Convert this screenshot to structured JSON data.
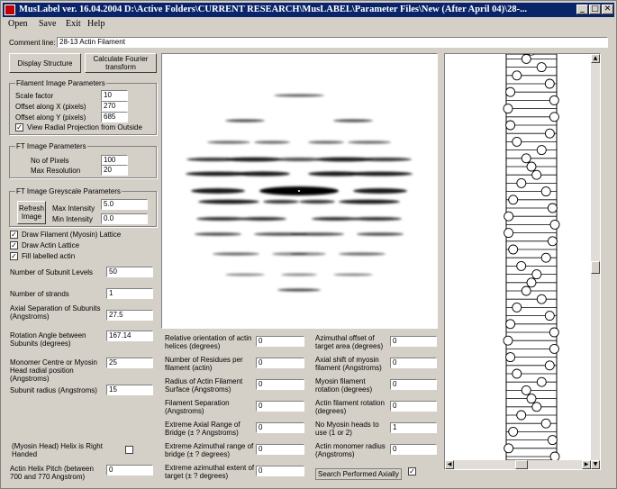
{
  "window": {
    "title": "MusLabel ver. 16.04.2004  D:\\Active Folders\\CURRENT RESEARCH\\MusLABEL\\Parameter Files\\New (After April 04)\\28-...",
    "minimize": "_",
    "maximize": "□",
    "close": "✕"
  },
  "menu": [
    "Open",
    "Save",
    "Exit",
    "Help"
  ],
  "comment": {
    "label": "Comment line:",
    "value": "28-13 Actin Filament"
  },
  "buttons": {
    "display_structure": "Display Structure",
    "calc_ft": "Calculate  Fourier transform",
    "refresh_image": "Refresh Image"
  },
  "filament_image": {
    "title": "Filament Image Parameters",
    "scale_label": "Scale factor",
    "scale_value": "10",
    "offx_label": "Offset along X (pixels)",
    "offx_value": "270",
    "offy_label": "Offset along Y (pixels)",
    "offy_value": "685",
    "radial_label": "View Radial Projection from Outside",
    "radial_checked": "✓"
  },
  "ft_image": {
    "title": "FT Image Parameters",
    "pixels_label": "No of Pixels",
    "pixels_value": "100",
    "res_label": "Max Resolution",
    "res_value": "20"
  },
  "greyscale": {
    "title": "FT Image Greyscale Parameters",
    "max_label": "Max Intensity",
    "max_value": "5.0",
    "min_label": "Min Intensity",
    "min_value": "0.0"
  },
  "checks": [
    {
      "label": "Draw Filament (Myosin) Lattice",
      "mark": "✓"
    },
    {
      "label": "Draw Actin Lattice",
      "mark": "✓"
    },
    {
      "label": "Fill labelled actin",
      "mark": "✓"
    }
  ],
  "left_params": {
    "subunit_levels_label": "Number of Subunit Levels",
    "subunit_levels_value": "50",
    "strands_label": "Number of strands",
    "strands_value": "1",
    "axial_sep_label": "Axial Separation of Subunits (Angstroms)",
    "axial_sep_value": "27.5",
    "rotation_label": "Rotation Angle between Subunits (degrees)",
    "rotation_value": "167.14",
    "monomer_label": "Monomer Centre or Myosin Head radial position (Angstroms)",
    "monomer_value": "25",
    "subunit_radius_label": "Subunit radius (Angstroms)",
    "subunit_radius_value": "15",
    "helix_label": "(Myosin Head) Helix is Right Handed",
    "helix_checked": "",
    "pitch_label": "Actin Helix Pitch (between 700 and 770 Angstrom)",
    "pitch_value": "0"
  },
  "middle_params": [
    {
      "label": "Relative orientation of actin helices (degrees)",
      "value": "0"
    },
    {
      "label": "Number of Residues per filament (actin)",
      "value": "0"
    },
    {
      "label": "Radius of Actin Filament Surface (Angstroms)",
      "value": "0"
    },
    {
      "label": "Filament Separation (Angstroms)",
      "value": "0"
    },
    {
      "label": "Extreme Axial Range of Bridge (± ? Angstroms)",
      "value": "0"
    },
    {
      "label": "Extreme Azimuthal range of bridge (± ? degrees)",
      "value": "0"
    },
    {
      "label": "Extreme azimuthal extent of target (± ? degrees)",
      "value": "0"
    }
  ],
  "right_params": [
    {
      "label": "Azimuthal offset of target area (degrees)",
      "value": "0"
    },
    {
      "label": "Axial shift of myosin filament (Angstroms)",
      "value": "0"
    },
    {
      "label": "Myosin filament rotation (degrees)",
      "value": "0"
    },
    {
      "label": "Actin filament rotation (degrees)",
      "value": "0"
    },
    {
      "label": "No Myosin heads to use (1 or 2)",
      "value": "1"
    },
    {
      "label": "Actin monomer radius (Angstroms)",
      "value": "0"
    }
  ],
  "search": {
    "label": "Search Performed Axially",
    "mark": "✓"
  },
  "colors": {
    "titlebar": "#0a246a",
    "face": "#d4d0c8",
    "ink": "#000000"
  }
}
